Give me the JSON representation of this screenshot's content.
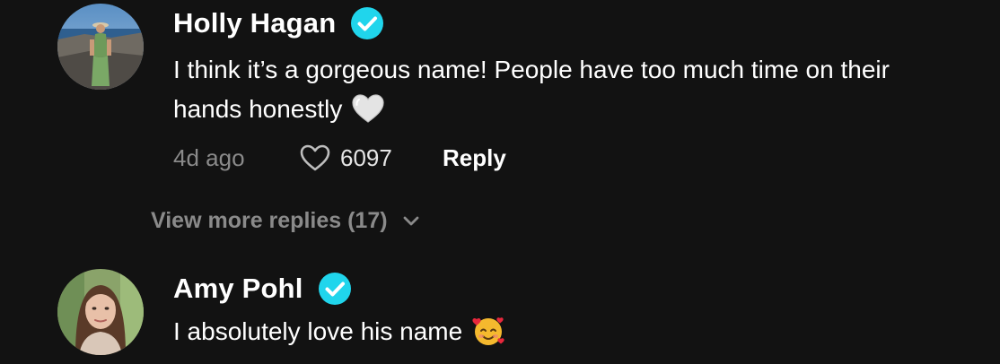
{
  "colors": {
    "background": "#121212",
    "text_primary": "#ffffff",
    "text_secondary": "#8a8a8a",
    "verified_badge": "#20d5ec"
  },
  "comments": [
    {
      "username": "Holly Hagan",
      "verified": true,
      "text": "I think it’s a gorgeous name! People have too much time on their",
      "text_line2": "hands honestly",
      "emoji": "white-heart",
      "timestamp": "4d ago",
      "likes": "6097",
      "reply_label": "Reply",
      "avatar_icon": "avatar-photo"
    },
    {
      "username": "Amy Pohl",
      "verified": true,
      "text": "I absolutely love his name",
      "emoji": "smiling-face-with-hearts",
      "avatar_icon": "avatar-photo"
    }
  ],
  "view_more_replies": "View more replies (17)"
}
